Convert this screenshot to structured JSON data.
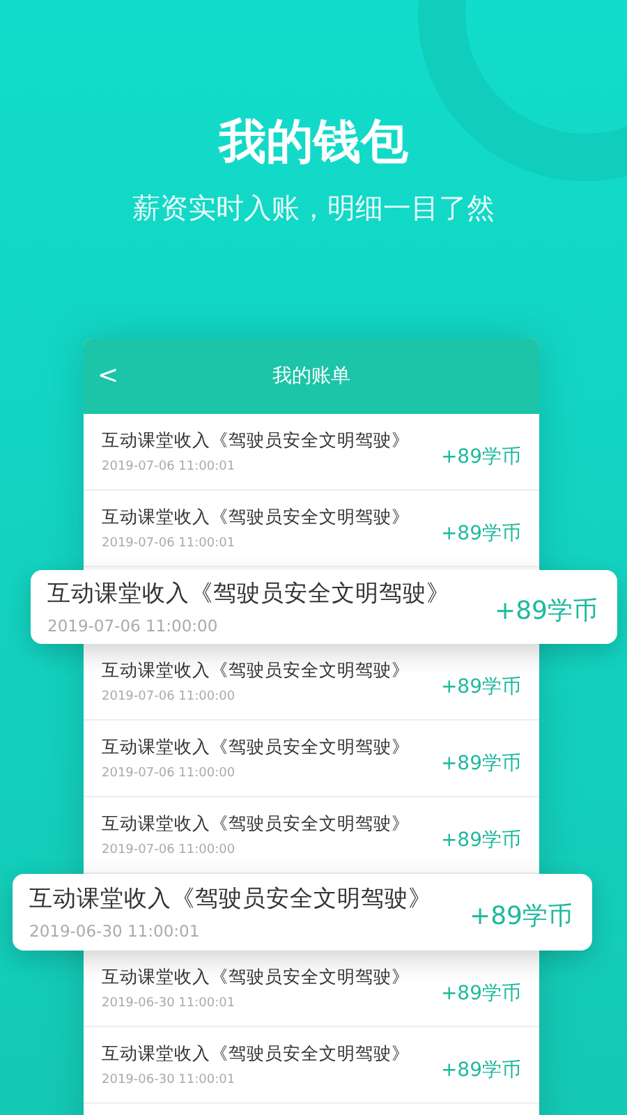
{
  "headline": "我的钱包",
  "tagline": "薪资实时入账，明细一目了然",
  "screen": {
    "back_icon": "<",
    "title": "我的账单"
  },
  "entries": [
    {
      "kind": "row",
      "title": "互动课堂收入《驾驶员安全文明驾驶》",
      "time": "2019-07-06 11:00:01",
      "amount": "+89学币"
    },
    {
      "kind": "row",
      "title": "互动课堂收入《驾驶员安全文明驾驶》",
      "time": "2019-07-06 11:00:01",
      "amount": "+89学币"
    },
    {
      "kind": "highlight",
      "title": "互动课堂收入《驾驶员安全文明驾驶》",
      "time": "2019-07-06 11:00:00",
      "amount": "+89学币"
    },
    {
      "kind": "row",
      "title": "互动课堂收入《驾驶员安全文明驾驶》",
      "time": "2019-07-06 11:00:00",
      "amount": "+89学币"
    },
    {
      "kind": "row",
      "title": "互动课堂收入《驾驶员安全文明驾驶》",
      "time": "2019-07-06 11:00:00",
      "amount": "+89学币"
    },
    {
      "kind": "row",
      "title": "互动课堂收入《驾驶员安全文明驾驶》",
      "time": "2019-07-06 11:00:00",
      "amount": "+89学币"
    },
    {
      "kind": "highlight",
      "title": "互动课堂收入《驾驶员安全文明驾驶》",
      "time": "2019-06-30 11:00:01",
      "amount": "+89学币"
    },
    {
      "kind": "row",
      "title": "互动课堂收入《驾驶员安全文明驾驶》",
      "time": "2019-06-30 11:00:01",
      "amount": "+89学币"
    },
    {
      "kind": "row",
      "title": "互动课堂收入《驾驶员安全文明驾驶》",
      "time": "2019-06-30 11:00:01",
      "amount": "+89学币"
    }
  ]
}
